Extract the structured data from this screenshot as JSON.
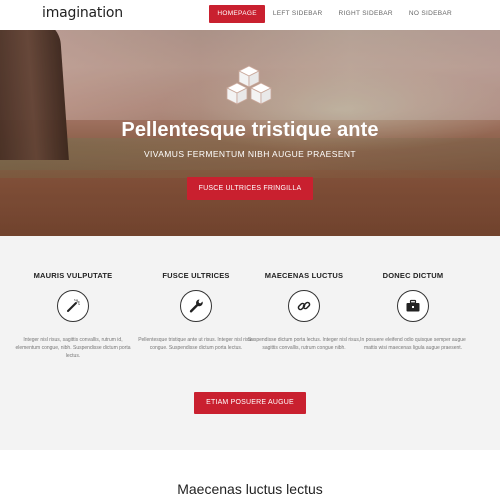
{
  "header": {
    "logo": "imagination",
    "nav": [
      {
        "label": "HOMEPAGE",
        "active": true
      },
      {
        "label": "LEFT SIDEBAR",
        "active": false
      },
      {
        "label": "RIGHT SIDEBAR",
        "active": false
      },
      {
        "label": "NO SIDEBAR",
        "active": false
      }
    ]
  },
  "hero": {
    "icon": "cubes-icon",
    "title": "Pellentesque tristique ante",
    "subtitle": "VIVAMUS FERMENTUM NIBH AUGUE PRAESENT",
    "button": "FUSCE ULTRICES FRINGILLA"
  },
  "features": {
    "items": [
      {
        "title": "MAURIS VULPUTATE",
        "icon": "magic-wand-icon",
        "text": "Integer nisl risus, sagittis convallis, rutrum id, elementum congue, nibh. Suspendisse dictum porta lectus."
      },
      {
        "title": "FUSCE ULTRICES",
        "icon": "wrench-icon",
        "text": "Pellentesque tristique ante ut risus. Integer nisl risus congue. Suspendisse dictum porta lectus."
      },
      {
        "title": "MAECENAS LUCTUS",
        "icon": "link-icon",
        "text": "Suspendisse dictum porta lectus. Integer nisl risus, sagittis convallis, rutrum congue nibh."
      },
      {
        "title": "DONEC DICTUM",
        "icon": "briefcase-icon",
        "text": "In posuere eleifend odio quisque semper augue mattis wisi maecenas ligula augue praesent."
      }
    ],
    "button": "ETIAM POSUERE AUGUE"
  },
  "section": {
    "title": "Maecenas luctus lectus"
  },
  "colors": {
    "accent": "#c9202f",
    "features_bg": "#f3f3f3"
  }
}
